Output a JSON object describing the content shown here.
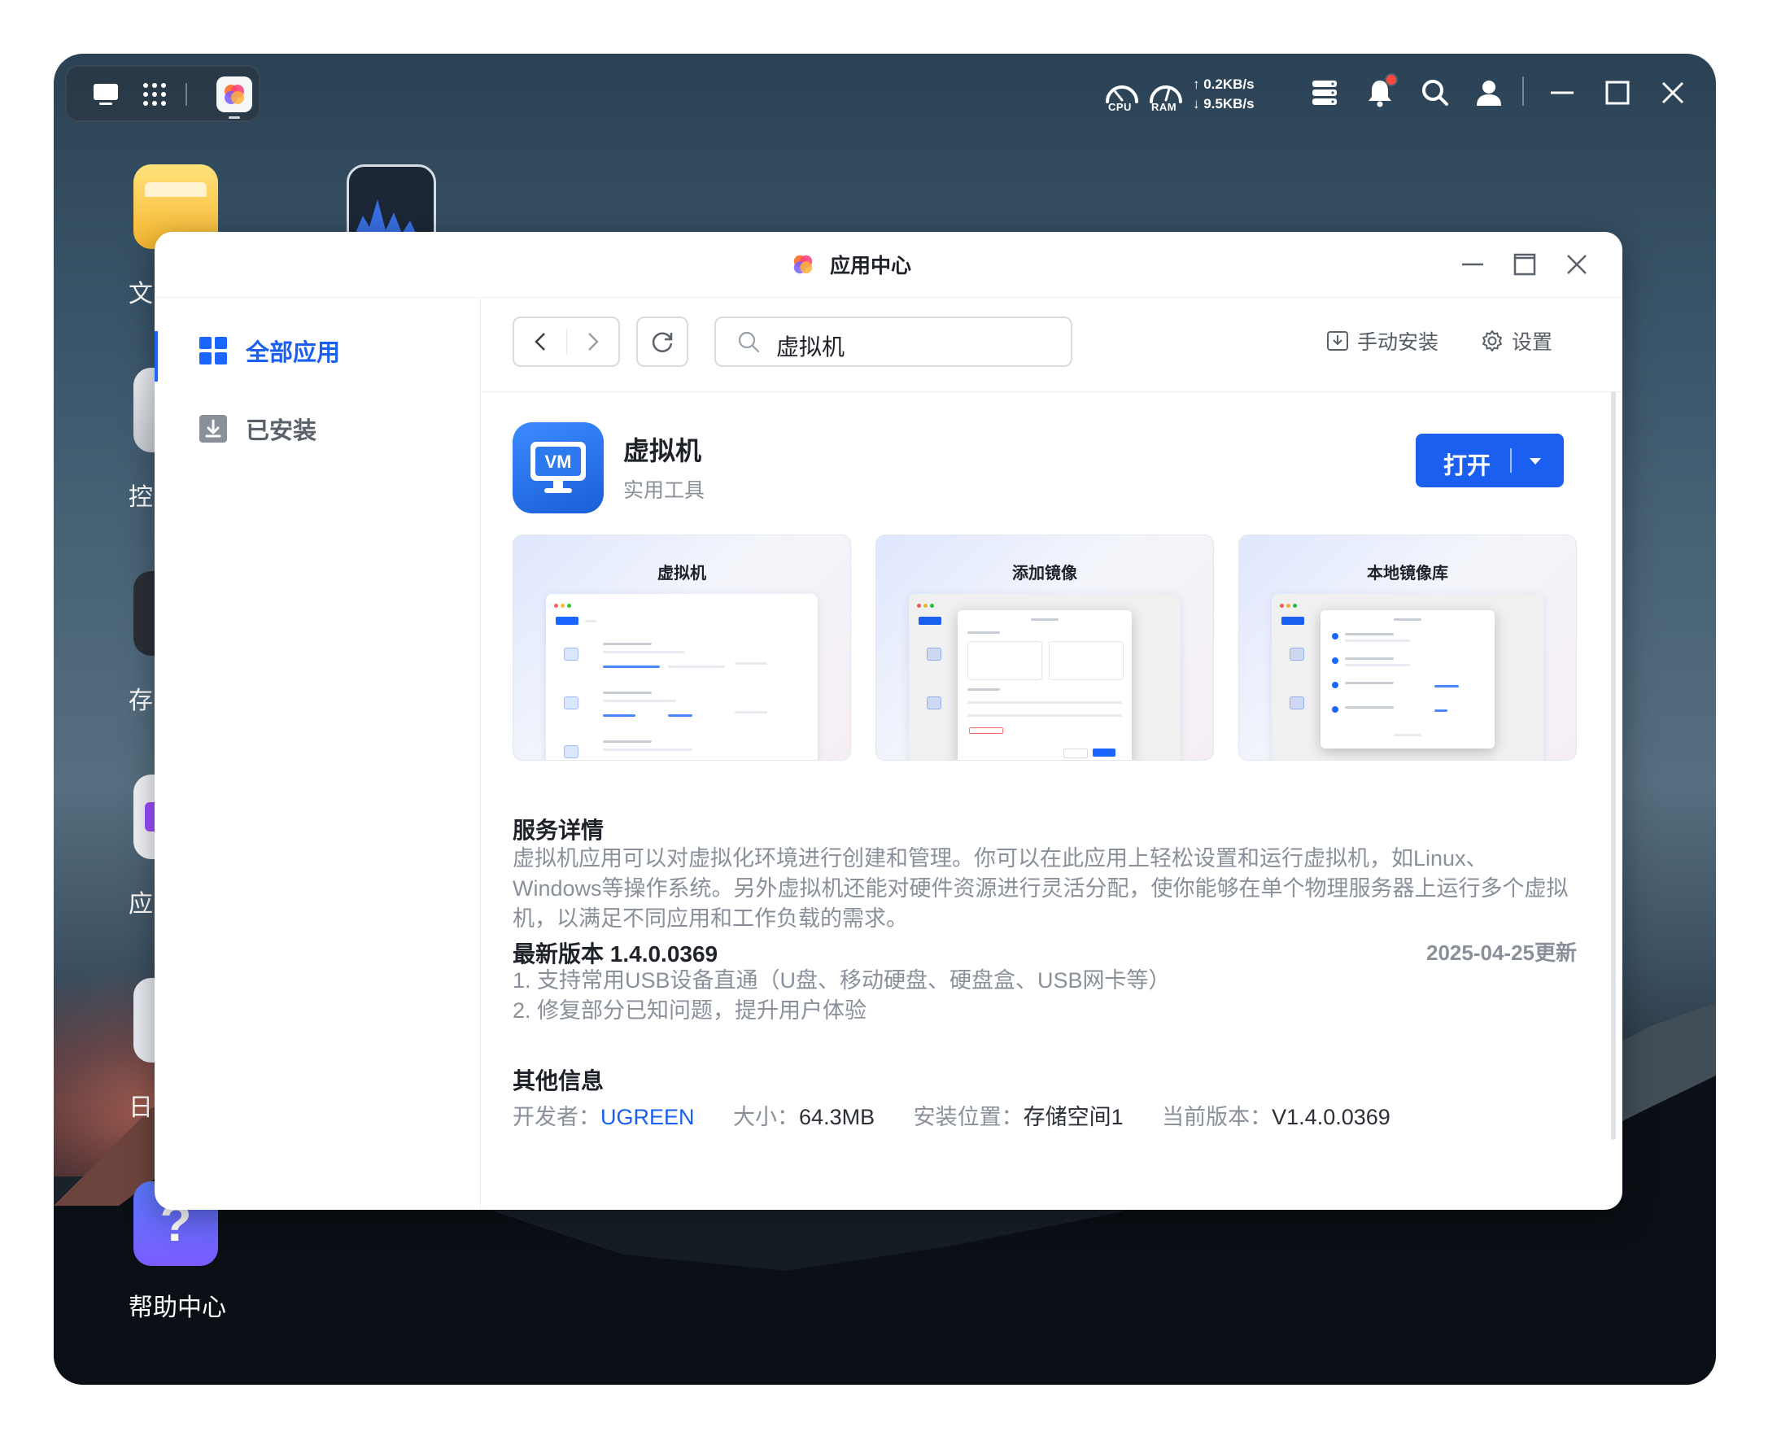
{
  "taskbar": {
    "cpu_label": "CPU",
    "ram_label": "RAM",
    "upload": "↑ 0.2KB/s",
    "download": "↓ 9.5KB/s"
  },
  "desktop_icons": [
    {
      "label": "文"
    },
    {
      "label": "控"
    },
    {
      "label": "存"
    },
    {
      "label": "应"
    },
    {
      "label": "日"
    },
    {
      "label": "帮助中心"
    }
  ],
  "window": {
    "title": "应用中心",
    "sidebar": {
      "items": [
        {
          "label": "全部应用",
          "active": true
        },
        {
          "label": "已安装",
          "active": false
        }
      ]
    },
    "toolbar": {
      "search_value": "虚拟机",
      "manual_install": "手动安装",
      "settings": "设置"
    },
    "app": {
      "name": "虚拟机",
      "category": "实用工具",
      "open_button": "打开",
      "icon_text": "VM"
    },
    "screenshots": [
      {
        "title": "虚拟机"
      },
      {
        "title": "添加镜像"
      },
      {
        "title": "本地镜像库"
      }
    ],
    "details": {
      "heading": "服务详情",
      "description": "虚拟机应用可以对虚拟化环境进行创建和管理。你可以在此应用上轻松设置和运行虚拟机，如Linux、Windows等操作系统。另外虚拟机还能对硬件资源进行灵活分配，使你能够在单个物理服务器上运行多个虚拟机，以满足不同应用和工作负载的需求。"
    },
    "version": {
      "heading": "最新版本 1.4.0.0369",
      "date": "2025-04-25更新",
      "notes": [
        "1. 支持常用USB设备直通（U盘、移动硬盘、硬盘盒、USB网卡等）",
        "2. 修复部分已知问题，提升用户体验"
      ]
    },
    "other": {
      "heading": "其他信息",
      "developer_label": "开发者：",
      "developer": "UGREEN",
      "size_label": "大小：",
      "size": "64.3MB",
      "location_label": "安装位置：",
      "location": "存储空间1",
      "current_label": "当前版本：",
      "current": "V1.4.0.0369"
    }
  },
  "colors": {
    "accent": "#1a5ff0",
    "text_primary": "#1f2329",
    "text_secondary": "#8a9099"
  }
}
